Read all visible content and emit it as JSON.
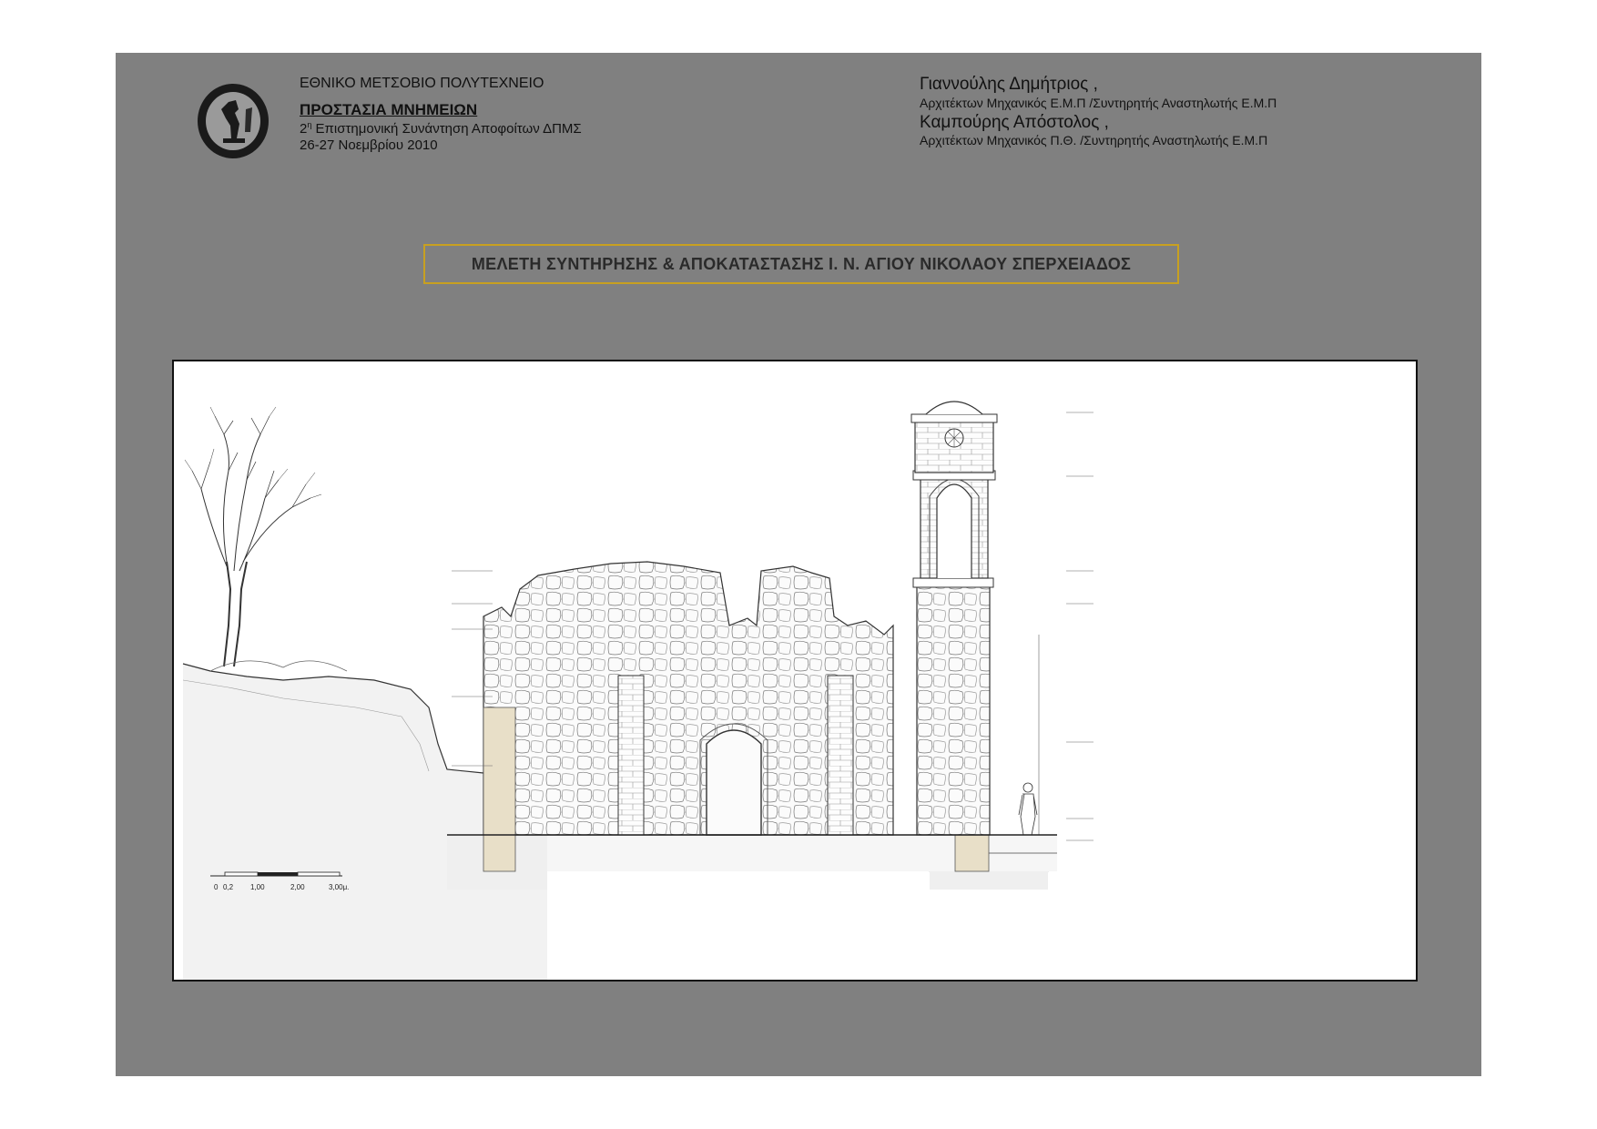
{
  "header": {
    "institution": "ΕΘΝΙΚΟ ΜΕΤΣΟΒΙΟ ΠΟΛΥΤΕΧΝΕΙΟ",
    "program": "ΠΡΟΣΤΑΣΙΑ ΜΝΗΜΕΙΩΝ",
    "meeting_ordinal": "2",
    "meeting_ordinal_sup": "η",
    "meeting": " Επιστημονική Συνάντηση Αποφοίτων  ΔΠΜΣ",
    "dates": "26-27 Νοεμβρίου  2010"
  },
  "authors": [
    {
      "name": "Γιαννούλης Δημήτριος ,",
      "role": "Αρχιτέκτων Μηχανικός Ε.Μ.Π /Συντηρητής Αναστηλωτής Ε.Μ.Π"
    },
    {
      "name": "Καμπούρης Απόστολος ,",
      "role": "Αρχιτέκτων Μηχανικός Π.Θ. /Συντηρητής Αναστηλωτής Ε.Μ.Π"
    }
  ],
  "title": "ΜΕΛΕΤΗ ΣΥΝΤΗΡΗΣΗΣ & ΑΠΟΚΑΤΑΣΤΑΣΗΣ Ι. Ν. ΑΓΙΟΥ ΝΙΚΟΛΑΟΥ ΣΠΕΡΧΕΙΑΔΟΣ",
  "scale_bar": {
    "labels": [
      "0",
      "0,2",
      "1,00",
      "2,00",
      "3,00μ."
    ]
  },
  "colors": {
    "poster_bg": "#808080",
    "title_border": "#c8a020",
    "foundation_fill": "#e8dfc8"
  }
}
